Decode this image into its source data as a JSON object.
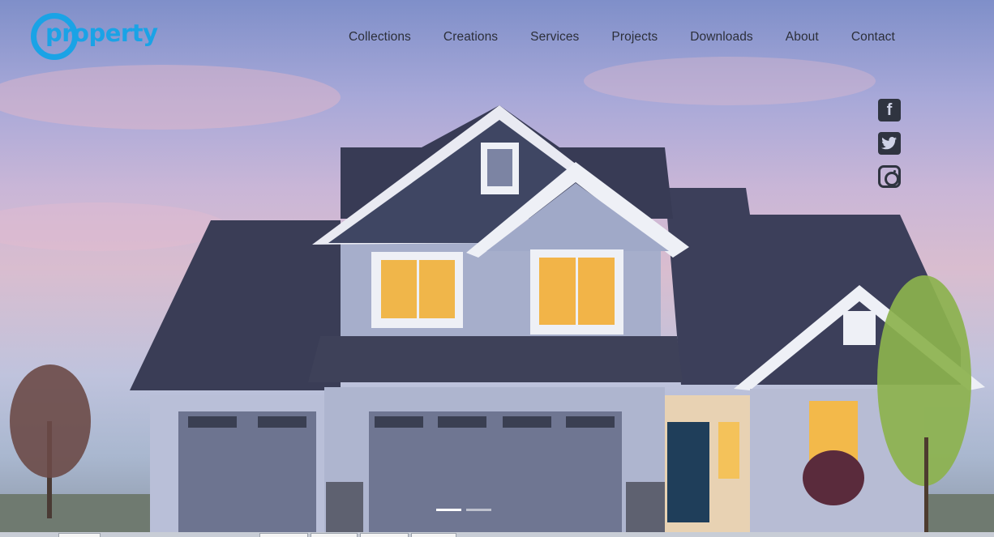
{
  "brand": {
    "name": "property",
    "color": "#1aa3e6"
  },
  "nav": {
    "items": [
      "Collections",
      "Creations",
      "Services",
      "Projects",
      "Downloads",
      "About",
      "Contact"
    ]
  },
  "social": [
    "facebook-icon",
    "twitter-icon",
    "instagram-icon"
  ],
  "slider": {
    "slides": 2,
    "active": 1
  }
}
